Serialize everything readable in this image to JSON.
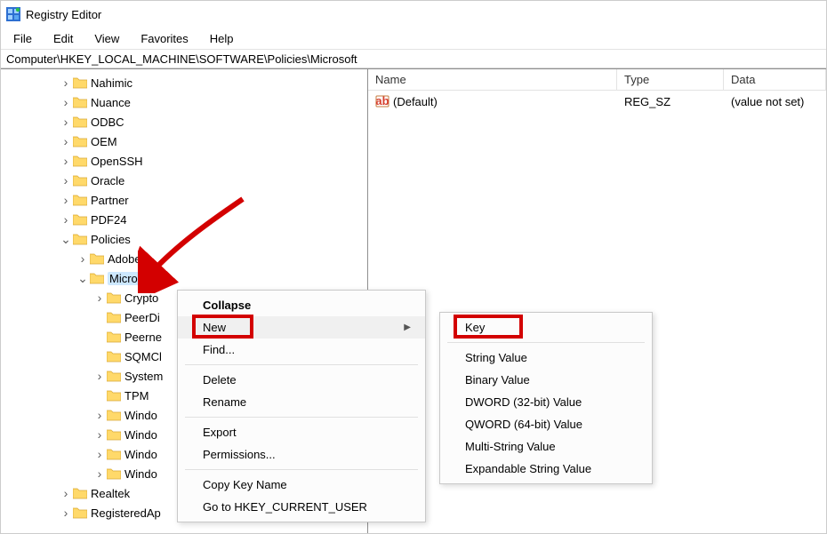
{
  "title": "Registry Editor",
  "menubar": [
    "File",
    "Edit",
    "View",
    "Favorites",
    "Help"
  ],
  "addressbar": "Computer\\HKEY_LOCAL_MACHINE\\SOFTWARE\\Policies\\Microsoft",
  "tree": [
    {
      "indent": 3,
      "tw": ">",
      "label": "Nahimic"
    },
    {
      "indent": 3,
      "tw": ">",
      "label": "Nuance"
    },
    {
      "indent": 3,
      "tw": ">",
      "label": "ODBC"
    },
    {
      "indent": 3,
      "tw": ">",
      "label": "OEM"
    },
    {
      "indent": 3,
      "tw": ">",
      "label": "OpenSSH"
    },
    {
      "indent": 3,
      "tw": ">",
      "label": "Oracle"
    },
    {
      "indent": 3,
      "tw": ">",
      "label": "Partner"
    },
    {
      "indent": 3,
      "tw": ">",
      "label": "PDF24"
    },
    {
      "indent": 3,
      "tw": "v",
      "label": "Policies"
    },
    {
      "indent": 4,
      "tw": ">",
      "label": "Adobe"
    },
    {
      "indent": 4,
      "tw": "v",
      "label": "Microsoft",
      "selected": true
    },
    {
      "indent": 5,
      "tw": ">",
      "label": "Crypto"
    },
    {
      "indent": 5,
      "tw": "",
      "label": "PeerDi"
    },
    {
      "indent": 5,
      "tw": "",
      "label": "Peerne"
    },
    {
      "indent": 5,
      "tw": "",
      "label": "SQMCl"
    },
    {
      "indent": 5,
      "tw": ">",
      "label": "System"
    },
    {
      "indent": 5,
      "tw": "",
      "label": "TPM"
    },
    {
      "indent": 5,
      "tw": ">",
      "label": "Windo"
    },
    {
      "indent": 5,
      "tw": ">",
      "label": "Windo"
    },
    {
      "indent": 5,
      "tw": ">",
      "label": "Windo"
    },
    {
      "indent": 5,
      "tw": ">",
      "label": "Windo"
    },
    {
      "indent": 3,
      "tw": ">",
      "label": "Realtek"
    },
    {
      "indent": 3,
      "tw": ">",
      "label": "RegisteredAp"
    }
  ],
  "values": {
    "columns": [
      "Name",
      "Type",
      "Data"
    ],
    "rows": [
      {
        "name": "(Default)",
        "type": "REG_SZ",
        "data": "(value not set)"
      }
    ]
  },
  "context_menu": {
    "items": [
      {
        "label": "Collapse",
        "bold": true
      },
      {
        "label": "New",
        "submenu": true,
        "hover": true
      },
      {
        "label": "Find..."
      },
      {
        "sep": true
      },
      {
        "label": "Delete"
      },
      {
        "label": "Rename"
      },
      {
        "sep": true
      },
      {
        "label": "Export"
      },
      {
        "label": "Permissions..."
      },
      {
        "sep": true
      },
      {
        "label": "Copy Key Name"
      },
      {
        "label": "Go to HKEY_CURRENT_USER"
      }
    ],
    "submenu": [
      {
        "label": "Key"
      },
      {
        "sep": true
      },
      {
        "label": "String Value"
      },
      {
        "label": "Binary Value"
      },
      {
        "label": "DWORD (32-bit) Value"
      },
      {
        "label": "QWORD (64-bit) Value"
      },
      {
        "label": "Multi-String Value"
      },
      {
        "label": "Expandable String Value"
      }
    ]
  }
}
